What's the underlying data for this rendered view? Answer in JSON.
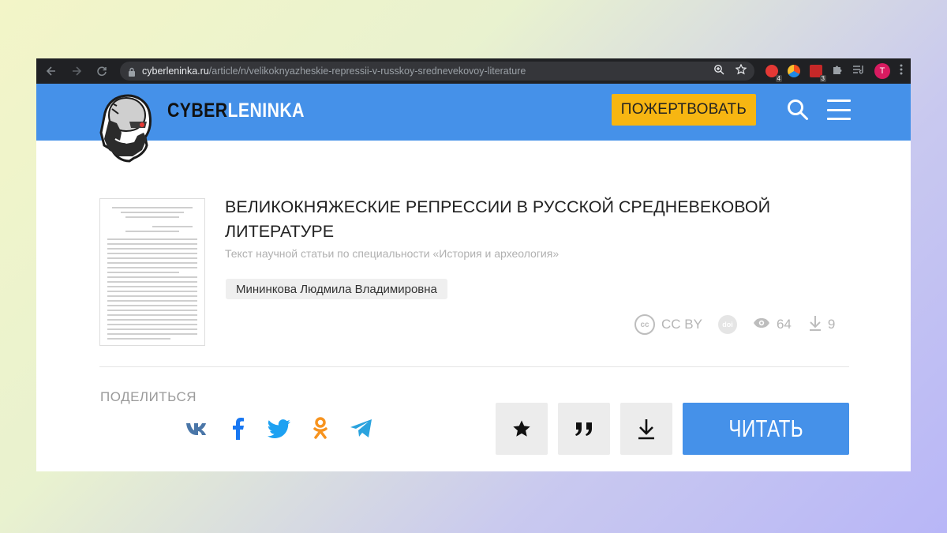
{
  "browser": {
    "url_host": "cyberleninka.ru",
    "url_path": "/article/n/velikoknyazheskie-repressii-v-russkoy-srednevekovoy-literature",
    "ext_badge_1": "4",
    "ext_badge_2": "3",
    "profile_initial": "T"
  },
  "header": {
    "logo_part1": "CYBER",
    "logo_part2": "LENINKA",
    "donate_label": "ПОЖЕРТВОВАТЬ"
  },
  "article": {
    "title": "ВЕЛИКОКНЯЖЕСКИЕ РЕПРЕССИИ В РУССКОЙ СРЕДНЕВЕКОВОЙ ЛИТЕРАТУРЕ",
    "subtitle": "Текст научной статьи по специальности «История и археология»",
    "author": "Мининкова Людмила Владимировна",
    "license_icon": "cc",
    "license": "CC BY",
    "doi_icon": "doi",
    "views": "64",
    "downloads": "9"
  },
  "share": {
    "label": "ПОДЕЛИТЬСЯ"
  },
  "actions": {
    "read_label": "ЧИТАТЬ"
  },
  "colors": {
    "brand_blue": "#4591e9",
    "donate_yellow": "#f7b612"
  }
}
